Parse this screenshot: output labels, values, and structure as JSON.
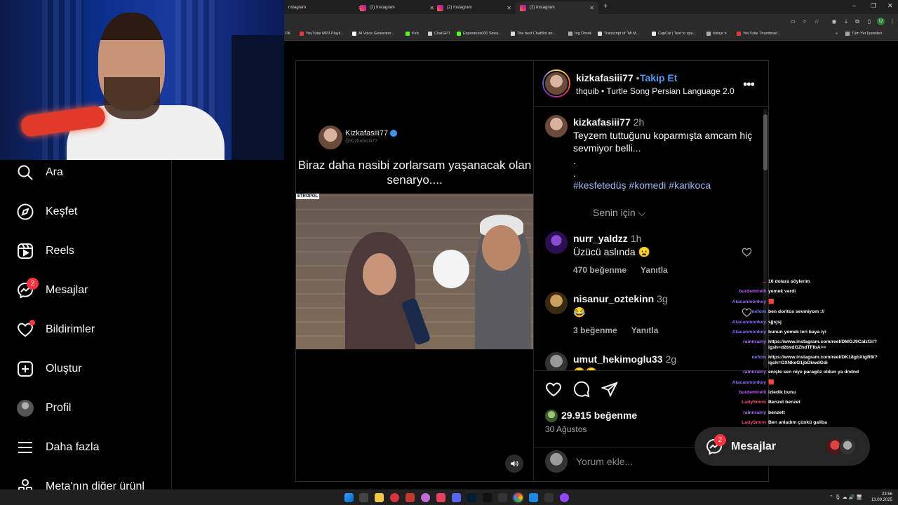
{
  "browser": {
    "tabs": [
      {
        "label": "nstagram"
      },
      {
        "label": "(2) Instagram"
      },
      {
        "label": "(2) Instagram"
      },
      {
        "label": "(2) Instagram"
      }
    ],
    "new_tab": "+",
    "window_controls": [
      "–",
      "❐",
      "✕"
    ],
    "profile_initial": "U",
    "bookmarks": [
      "PK",
      "YouTube MP3 Playli...",
      "AI Voice Generator...",
      "Kick",
      "ChatGPT",
      "Esperanza000 Strea...",
      "The best ChatBot an...",
      "İng Örnek",
      "Transcript of \"Mi M...",
      "CapCut | Text to spe...",
      "türkçe h.",
      "YouTube Thumbnail...",
      "»",
      "Tüm Yer İşaretleri"
    ]
  },
  "sidebar": {
    "items": [
      {
        "label": "Ara",
        "icon": "search-icon"
      },
      {
        "label": "Keşfet",
        "icon": "compass-icon"
      },
      {
        "label": "Reels",
        "icon": "reels-icon"
      },
      {
        "label": "Mesajlar",
        "icon": "messenger-icon",
        "badge": "2"
      },
      {
        "label": "Bildirimler",
        "icon": "heart-icon",
        "dot": true
      },
      {
        "label": "Oluştur",
        "icon": "create-icon"
      },
      {
        "label": "Profil",
        "icon": "avatar"
      },
      {
        "label": "Daha fazla",
        "icon": "menu-icon"
      },
      {
        "label": "Meta'nın diğer ürünl",
        "icon": "meta-icon"
      }
    ]
  },
  "post": {
    "media": {
      "overlay_user": "Kizkafasiii77",
      "overlay_handle": "@Kizkafasiii77",
      "overlay_caption": "Biraz daha nasibi zorlarsam yaşanacak olan senaryo....",
      "video_tag": "ETROPOL"
    },
    "header": {
      "username": "kizkafasiii77",
      "separator": "•",
      "follow": "Takip Et",
      "audio": "thquib • Turtle Song Persian Language 2.0",
      "more": "•••"
    },
    "caption": {
      "username": "kizkafasiii77",
      "time": "2h",
      "text": "Teyzem tuttuğunu koparmışta amcam hiç sevmiyor belli...",
      "dots": ".\n.",
      "hashtags": "#kesfetedüş #komedi #karikoca",
      "translation": "Senin için ⌵"
    },
    "comments": [
      {
        "username": "nurr_yaldzz",
        "time": "1h",
        "text": "Üzücü aslında 😦",
        "likes": "470 beğenme",
        "reply": "Yanıtla"
      },
      {
        "username": "nisanur_oztekinn",
        "time": "3g",
        "text": "😂",
        "likes": "3 beğenme",
        "reply": "Yanıtla"
      },
      {
        "username": "umut_hekimoglu33",
        "time": "2g",
        "text": "😂😂",
        "likes": "",
        "reply": ""
      }
    ],
    "likes": "29.915 beğenme",
    "date": "30 Ağustos",
    "comment_placeholder": "Yorum ekle..."
  },
  "chat": [
    {
      "name": "...",
      "msg": "10 dolara söylerim",
      "color": "#ff4a4a"
    },
    {
      "name": "burdemirelli",
      "msg": "yemek verdi",
      "color": "#c060ff"
    },
    {
      "name": "Atacanmonkey",
      "msg": "🟥",
      "color": "#8a6bff"
    },
    {
      "name": "nefom",
      "msg": "ben doritos sevmiyom ://",
      "color": "#7a7aff"
    },
    {
      "name": "Atacanmonkey",
      "msg": "sjjsjsj",
      "color": "#8a6bff"
    },
    {
      "name": "Atacanmonkey",
      "msg": "bunun yemek leri baya iyi",
      "color": "#8a6bff"
    },
    {
      "name": "rainnrainy",
      "msg": "https://www.instagram.com/reel/DMOJ9CaIzGi/?igsh=d2twdGZhdTFIbA==",
      "color": "#b06bff"
    },
    {
      "name": "nefom",
      "msg": "https://www.instagram.com/reel/DK18gbXtgR8/?igsh=OXNkeG1jbDkwdGdi",
      "color": "#7a7aff"
    },
    {
      "name": "rainnrainy",
      "msg": "enişte sen niye paragöz oldun ya dndnd",
      "color": "#b06bff"
    },
    {
      "name": "Atacanmonkey",
      "msg": "🟥",
      "color": "#8a6bff"
    },
    {
      "name": "burdemirelli",
      "msg": "izledik bunu",
      "color": "#c060ff"
    },
    {
      "name": "LadySmnn",
      "msg": "Benzet benzet",
      "color": "#ff4a7a"
    },
    {
      "name": "rainnrainy",
      "msg": "benzett",
      "color": "#b06bff"
    },
    {
      "name": "LadySmnn",
      "msg": "Ben anladım çünkü galiba",
      "color": "#ff4a7a"
    }
  ],
  "messages_pill": {
    "label": "Mesajlar",
    "badge": "2"
  },
  "taskbar": {
    "time": "23:56",
    "date": "13.09.2025",
    "tray": "⌃  🎙  ☁  🔊  🖥"
  },
  "colors": {
    "accent_blue": "#4a9df0",
    "hashtag": "#a0b3f5",
    "badge_red": "#ff3040"
  }
}
